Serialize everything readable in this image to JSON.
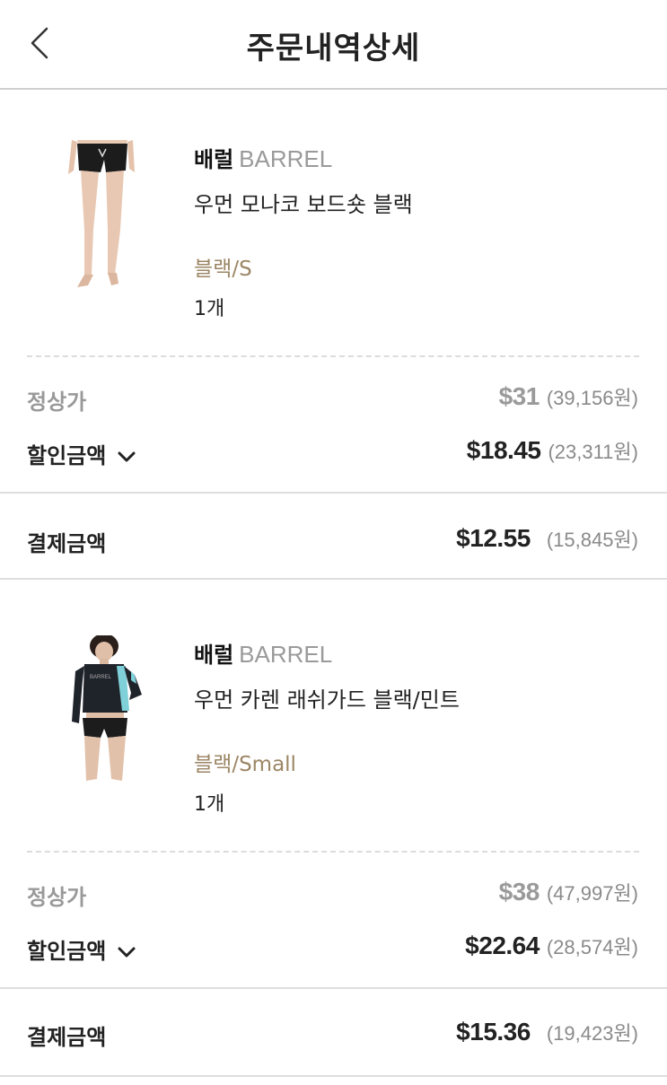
{
  "header": {
    "title": "주문내역상세"
  },
  "colors": {
    "option": "#9c8665",
    "muted": "#9a9a9a",
    "text": "#222222"
  },
  "orders": [
    {
      "brand_ko": "배럴",
      "brand_en": "BARREL",
      "product_name": "우먼 모나코 보드숏 블랙",
      "option": "블랙/S",
      "quantity": "1개",
      "regular_label": "정상가",
      "regular_usd": "$31",
      "regular_krw": "(39,156원)",
      "discount_label": "할인금액",
      "discount_usd": "$18.45",
      "discount_krw": "(23,311원)",
      "pay_label": "결제금액",
      "pay_usd": "$12.55",
      "pay_krw": "(15,845원)"
    },
    {
      "brand_ko": "배럴",
      "brand_en": "BARREL",
      "product_name": "우먼 카렌 래쉬가드 블랙/민트",
      "option": "블랙/Small",
      "quantity": "1개",
      "regular_label": "정상가",
      "regular_usd": "$38",
      "regular_krw": "(47,997원)",
      "discount_label": "할인금액",
      "discount_usd": "$22.64",
      "discount_krw": "(28,574원)",
      "pay_label": "결제금액",
      "pay_usd": "$15.36",
      "pay_krw": "(19,423원)"
    }
  ],
  "icons": {
    "back": "back-arrow-icon",
    "chevron": "chevron-down-icon"
  }
}
